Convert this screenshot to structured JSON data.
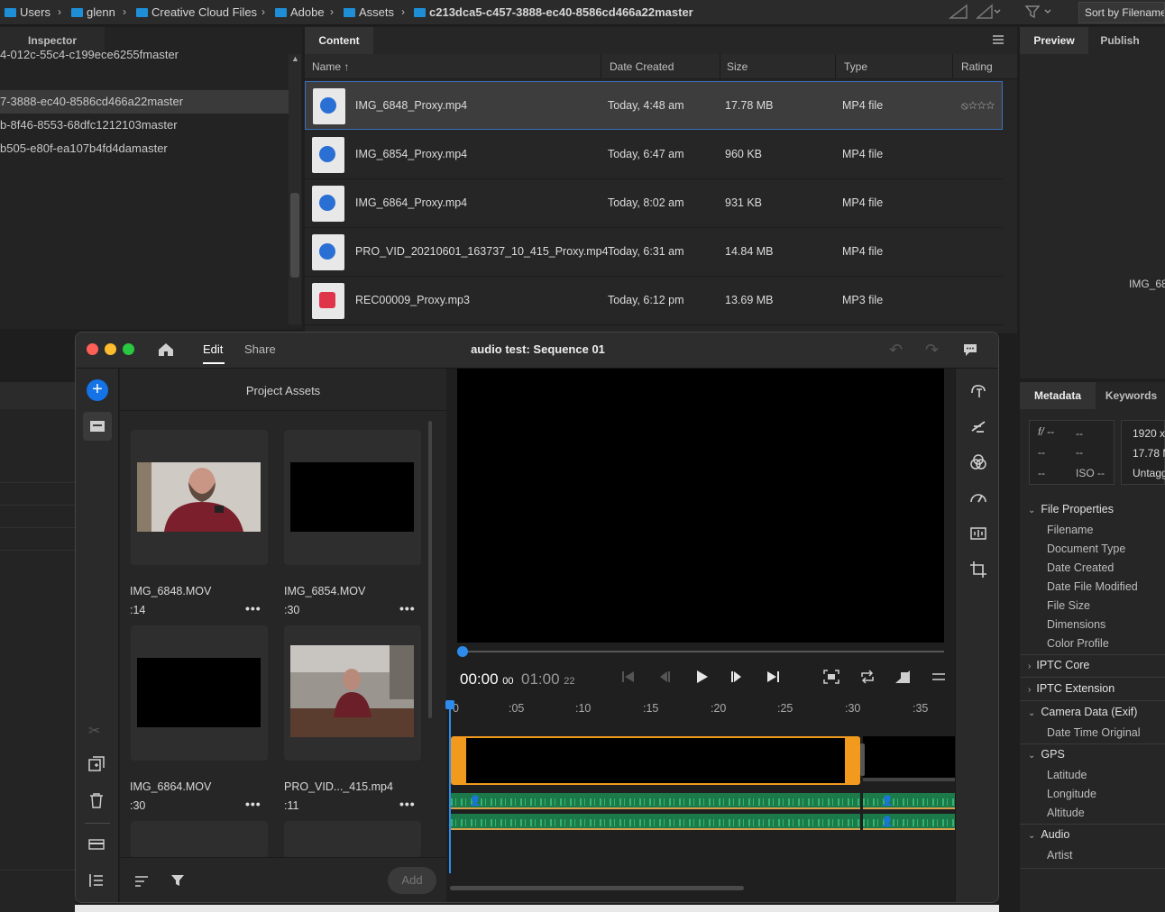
{
  "breadcrumb": [
    {
      "label": "Users",
      "bold": false
    },
    {
      "label": "glenn",
      "bold": false
    },
    {
      "label": "Creative Cloud Files",
      "bold": false
    },
    {
      "label": "Adobe",
      "bold": false
    },
    {
      "label": "Assets",
      "bold": false
    },
    {
      "label": "c213dca5-c457-3888-ec40-8586cd466a22master",
      "bold": true
    }
  ],
  "toolbar": {
    "sort_label": "Sort by Filename"
  },
  "inspector": {
    "tab": "Inspector",
    "folders": [
      "4-012c-55c4-c199ece6255fmaster",
      "7-3888-ec40-8586cd466a22master",
      "b-8f46-8553-68dfc1212103master",
      "b505-e80f-ea107b4fd4damaster"
    ]
  },
  "content": {
    "tab": "Content",
    "columns": {
      "name": "Name",
      "date": "Date Created",
      "size": "Size",
      "type": "Type",
      "rating": "Rating"
    },
    "files": [
      {
        "name": "IMG_6848_Proxy.mp4",
        "date": "Today, 4:48 am",
        "size": "17.78 MB",
        "type": "MP4 file",
        "kind": "video"
      },
      {
        "name": "IMG_6854_Proxy.mp4",
        "date": "Today, 6:47 am",
        "size": "960 KB",
        "type": "MP4 file",
        "kind": "video"
      },
      {
        "name": "IMG_6864_Proxy.mp4",
        "date": "Today, 8:02 am",
        "size": "931 KB",
        "type": "MP4 file",
        "kind": "video"
      },
      {
        "name": "PRO_VID_20210601_163737_10_415_Proxy.mp4",
        "date": "Today, 6:31 am",
        "size": "14.84 MB",
        "type": "MP4 file",
        "kind": "video"
      },
      {
        "name": "REC00009_Proxy.mp3",
        "date": "Today, 6:12 pm",
        "size": "13.69 MB",
        "type": "MP3 file",
        "kind": "audio"
      }
    ]
  },
  "preview": {
    "tabs": [
      "Preview",
      "Publish"
    ],
    "caption": "IMG_68"
  },
  "metadata": {
    "tabs": [
      "Metadata",
      "Keywords"
    ],
    "quick": {
      "aperture": "f/ --",
      "shutter": "--",
      "r2a": "--",
      "r2b": "--",
      "r3a": "--",
      "iso": "ISO --",
      "dim": "1920 x",
      "size": "17.78 M",
      "tag": "Untagg"
    },
    "sections": [
      {
        "title": "File Properties",
        "open": true,
        "items": [
          "Filename",
          "Document Type",
          "Date Created",
          "Date File Modified",
          "File Size",
          "Dimensions",
          "Color Profile"
        ]
      },
      {
        "title": "IPTC Core",
        "open": false,
        "items": []
      },
      {
        "title": "IPTC Extension",
        "open": false,
        "items": []
      },
      {
        "title": "Camera Data (Exif)",
        "open": true,
        "items": [
          "Date Time Original"
        ]
      },
      {
        "title": "GPS",
        "open": true,
        "items": [
          "Latitude",
          "Longitude",
          "Altitude"
        ]
      },
      {
        "title": "Audio",
        "open": true,
        "items": [
          "Artist"
        ]
      }
    ]
  },
  "rush": {
    "tabs": {
      "edit": "Edit",
      "share": "Share"
    },
    "title": "audio test: Sequence 01",
    "assets_title": "Project Assets",
    "assets": [
      {
        "name": "IMG_6848.MOV",
        "dur": ":14",
        "thumb": "person"
      },
      {
        "name": "IMG_6854.MOV",
        "dur": ":30",
        "thumb": "black"
      },
      {
        "name": "IMG_6864.MOV",
        "dur": ":30",
        "thumb": "black"
      },
      {
        "name": "PRO_VID..._415.mp4",
        "dur": ":11",
        "thumb": "room"
      }
    ],
    "add_label": "Add",
    "timecode_current": "00:00",
    "timecode_current_frames": "00",
    "timecode_total": "01:00",
    "timecode_total_frames": "22",
    "ruler": [
      ":05",
      ":10",
      ":15",
      ":20",
      ":25",
      ":30",
      ":35"
    ]
  }
}
